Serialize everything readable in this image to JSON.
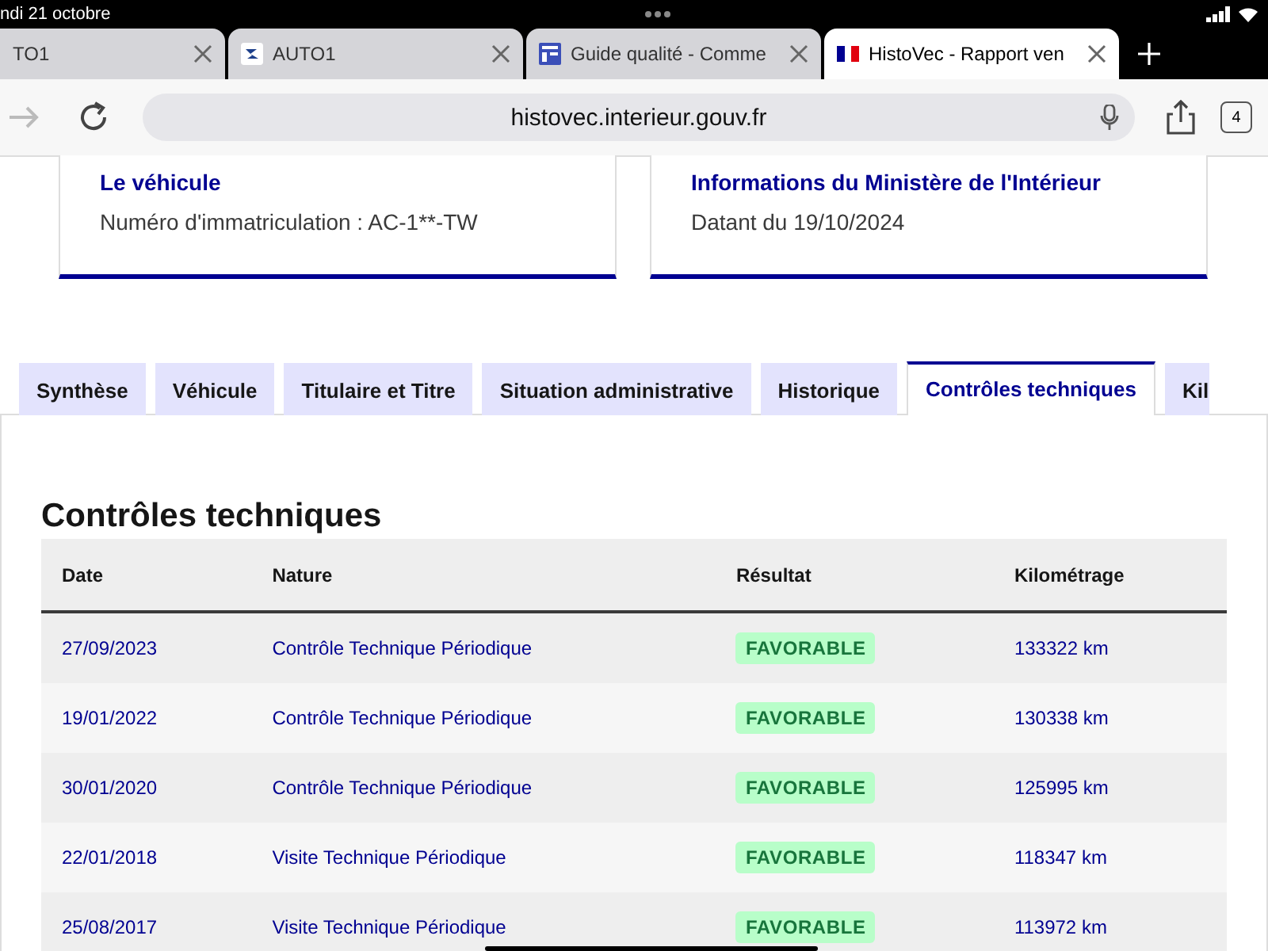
{
  "status_bar": {
    "date": "ndi 21 octobre"
  },
  "browser_tabs": [
    {
      "title": "TO1",
      "kind": "plain",
      "selected": false
    },
    {
      "title": "AUTO1",
      "kind": "logo",
      "selected": false
    },
    {
      "title": "Guide qualité - Comme",
      "kind": "doc",
      "selected": false
    },
    {
      "title": "HistoVec - Rapport ven",
      "kind": "flag",
      "selected": true
    }
  ],
  "address_bar": {
    "url": "histovec.interieur.gouv.fr",
    "tab_count": "4"
  },
  "cards": [
    {
      "title": "Le véhicule",
      "text": "Numéro d'immatriculation : AC-1**-TW"
    },
    {
      "title": "Informations du Ministère de l'Intérieur",
      "text": "Datant du 19/10/2024"
    }
  ],
  "page_tabs": [
    {
      "label": "Synthèse",
      "selected": false
    },
    {
      "label": "Véhicule",
      "selected": false
    },
    {
      "label": "Titulaire et Titre",
      "selected": false
    },
    {
      "label": "Situation administrative",
      "selected": false
    },
    {
      "label": "Historique",
      "selected": false
    },
    {
      "label": "Contrôles techniques",
      "selected": true
    },
    {
      "label": "Kil",
      "selected": false
    }
  ],
  "section_title": "Contrôles techniques",
  "table": {
    "columns": [
      "Date",
      "Nature",
      "Résultat",
      "Kilométrage"
    ],
    "rows": [
      {
        "date": "27/09/2023",
        "nature": "Contrôle Technique Périodique",
        "result": "FAVORABLE",
        "mileage": "133322 km"
      },
      {
        "date": "19/01/2022",
        "nature": "Contrôle Technique Périodique",
        "result": "FAVORABLE",
        "mileage": "130338 km"
      },
      {
        "date": "30/01/2020",
        "nature": "Contrôle Technique Périodique",
        "result": "FAVORABLE",
        "mileage": "125995 km"
      },
      {
        "date": "22/01/2018",
        "nature": "Visite Technique Périodique",
        "result": "FAVORABLE",
        "mileage": "118347 km"
      },
      {
        "date": "25/08/2017",
        "nature": "Visite Technique Périodique",
        "result": "FAVORABLE",
        "mileage": "113972 km"
      }
    ]
  }
}
